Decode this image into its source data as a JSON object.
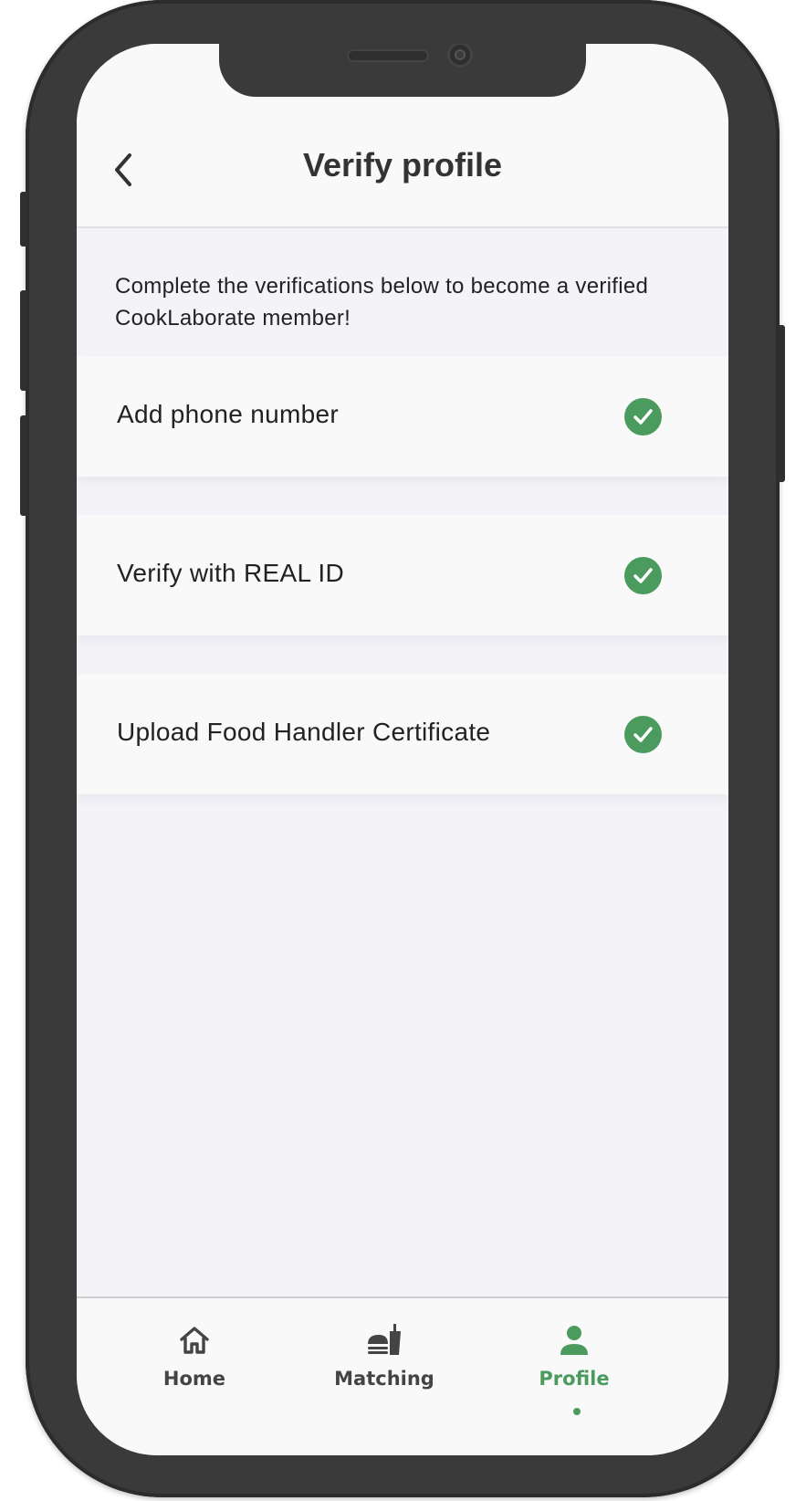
{
  "header": {
    "title": "Verify profile",
    "back_icon": "chevron-left-icon"
  },
  "intro_text": "Complete the verifications below to become a verified CookLaborate member!",
  "verifications": [
    {
      "label": "Add phone number",
      "status": "complete",
      "icon": "check-circle-icon"
    },
    {
      "label": "Verify with REAL ID",
      "status": "complete",
      "icon": "check-circle-icon"
    },
    {
      "label": "Upload Food Handler Certificate",
      "status": "complete",
      "icon": "check-circle-icon"
    }
  ],
  "tabbar": {
    "tabs": [
      {
        "label": "Home",
        "icon": "home-icon",
        "active": false
      },
      {
        "label": "Matching",
        "icon": "food-icon",
        "active": false
      },
      {
        "label": "Profile",
        "icon": "person-icon",
        "active": true
      }
    ]
  },
  "colors": {
    "accent": "#4b9b5f",
    "background": "#f4f3f8",
    "surface": "#f9f9f9",
    "text": "#222222",
    "frame": "#3a3a3a"
  }
}
